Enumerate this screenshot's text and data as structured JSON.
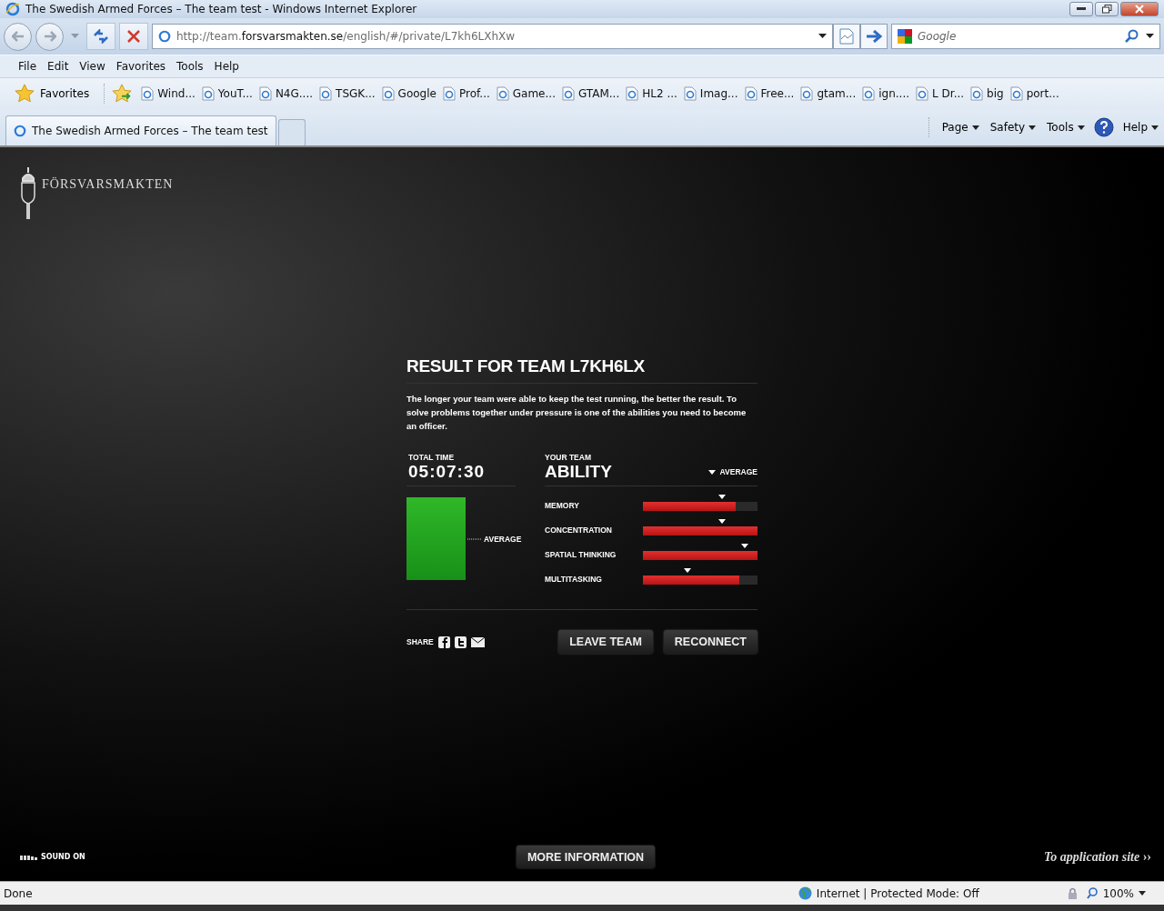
{
  "window": {
    "title": "The Swedish Armed Forces – The team test - Windows Internet Explorer"
  },
  "address_bar": {
    "url_prefix": "http://team.",
    "url_domain": "forsvarsmakten.se",
    "url_path": "/english/#/private/L7kh6LXhXw"
  },
  "search": {
    "placeholder": "Google"
  },
  "menu": [
    "File",
    "Edit",
    "View",
    "Favorites",
    "Tools",
    "Help"
  ],
  "favorites": {
    "label": "Favorites",
    "items": [
      "Wind...",
      "YouT...",
      "N4G....",
      "TSGK...",
      "Google",
      "Prof...",
      "Game...",
      "GTAM...",
      "HL2 ...",
      "Imag...",
      "Free...",
      "gtam...",
      "ign....",
      "L Dr...",
      "big",
      "port..."
    ]
  },
  "tabs": [
    {
      "label": "The Swedish Armed Forces – The team test",
      "selected": true
    },
    {
      "selected": false
    }
  ],
  "command_bar": [
    "Page",
    "Safety",
    "Tools",
    "Help"
  ],
  "site": {
    "logo_text": "FÖRSVARSMAKTEN",
    "result": {
      "title": "RESULT FOR TEAM L7KH6LX",
      "description": "The longer your team were able to keep the test running, the better the result. To solve problems together under pressure is one of the abilities you need to become an officer.",
      "total_time_label": "TOTAL TIME",
      "total_time": "05:07:30",
      "average_label": "AVERAGE",
      "ability_caption": "YOUR TEAM",
      "ability_title": "ABILITY",
      "legend_label": "AVERAGE",
      "abilities": [
        {
          "name": "MEMORY",
          "level": 0.81,
          "average": {
            "level": 0.69
          }
        },
        {
          "name": "CONCENTRATION",
          "level": 1.0,
          "average": {
            "level": 0.69
          }
        },
        {
          "name": "SPATIAL THINKING",
          "level": 1.0,
          "average": {
            "level": 0.89
          }
        },
        {
          "name": "MULTITASKING",
          "level": 0.84,
          "average": {
            "level": 0.39
          }
        }
      ],
      "share_label": "SHARE",
      "buttons": [
        "LEAVE TEAM",
        "RECONNECT"
      ]
    },
    "sound_label": "SOUND ON",
    "more_button": "MORE INFORMATION",
    "app_link": "To application site",
    "app_link_arrow": "››"
  },
  "status_bar": {
    "status": "Done",
    "zone": "Internet | Protected Mode: Off",
    "zoom": "100%"
  }
}
